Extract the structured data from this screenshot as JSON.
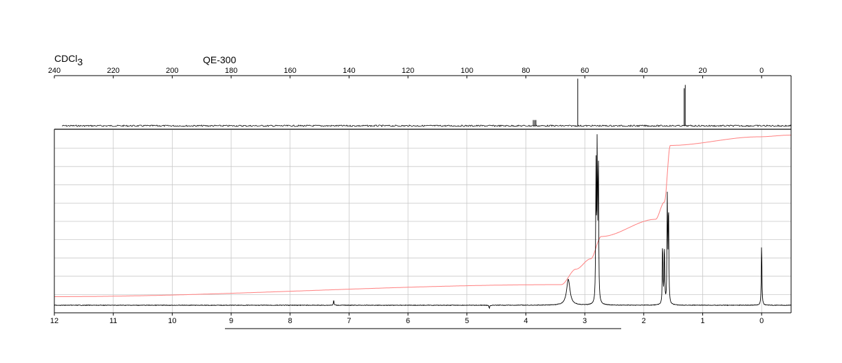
{
  "header": {
    "solvent_base": "CDCl",
    "solvent_sub": "3",
    "instrument": "QE-300"
  },
  "chart_data": [
    {
      "type": "line",
      "name": "13C NMR spectrum",
      "x_axis": {
        "range": [
          240,
          -10
        ],
        "reversed": true,
        "ticks": [
          240,
          220,
          200,
          180,
          160,
          140,
          120,
          100,
          80,
          60,
          40,
          20,
          0
        ],
        "tick_labels": [
          "240",
          "220",
          "200",
          "180",
          "160",
          "140",
          "120",
          "100",
          "80",
          "60",
          "40",
          "20",
          "0"
        ],
        "unit": "ppm"
      },
      "grid": false,
      "peaks": [
        {
          "ppm": 77.5,
          "height": 0.12
        },
        {
          "ppm": 77.0,
          "height": 0.12
        },
        {
          "ppm": 76.6,
          "height": 0.12
        },
        {
          "ppm": 62.4,
          "height": 0.98
        },
        {
          "ppm": 26.3,
          "height": 0.78
        },
        {
          "ppm": 25.9,
          "height": 0.85
        }
      ]
    },
    {
      "type": "line",
      "name": "1H NMR spectrum",
      "x_axis": {
        "range": [
          12,
          -0.5
        ],
        "reversed": true,
        "ticks": [
          12,
          11,
          10,
          9,
          8,
          7,
          6,
          5,
          4,
          3,
          2,
          1,
          0
        ],
        "tick_labels": [
          "12",
          "11",
          "10",
          "9",
          "8",
          "7",
          "6",
          "5",
          "4",
          "3",
          "2",
          "1",
          "0"
        ],
        "unit": "ppm"
      },
      "grid": true,
      "peaks": [
        {
          "ppm": 7.26,
          "height": 0.03
        },
        {
          "ppm": 4.62,
          "height": -0.02
        },
        {
          "ppm": 3.28,
          "height": 0.15,
          "broad": true
        },
        {
          "ppm": 2.81,
          "height": 0.8
        },
        {
          "ppm": 2.79,
          "height": 0.9
        },
        {
          "ppm": 2.77,
          "height": 0.85
        },
        {
          "ppm": 1.68,
          "height": 0.37
        },
        {
          "ppm": 1.65,
          "height": 0.35
        },
        {
          "ppm": 1.6,
          "height": 0.62
        },
        {
          "ppm": 1.58,
          "height": 0.58
        },
        {
          "ppm": 0.0,
          "height": 0.37
        }
      ],
      "integral": {
        "color": "#ff7f7f",
        "points": [
          {
            "ppm": 12.0,
            "level": 0.05
          },
          {
            "ppm": 3.4,
            "level": 0.12
          },
          {
            "ppm": 3.15,
            "level": 0.21
          },
          {
            "ppm": 2.9,
            "level": 0.27
          },
          {
            "ppm": 2.72,
            "level": 0.4
          },
          {
            "ppm": 1.8,
            "level": 0.5
          },
          {
            "ppm": 1.65,
            "level": 0.6
          },
          {
            "ppm": 1.55,
            "level": 0.93
          },
          {
            "ppm": 0.05,
            "level": 0.98
          },
          {
            "ppm": -0.5,
            "level": 0.99
          }
        ]
      }
    }
  ]
}
